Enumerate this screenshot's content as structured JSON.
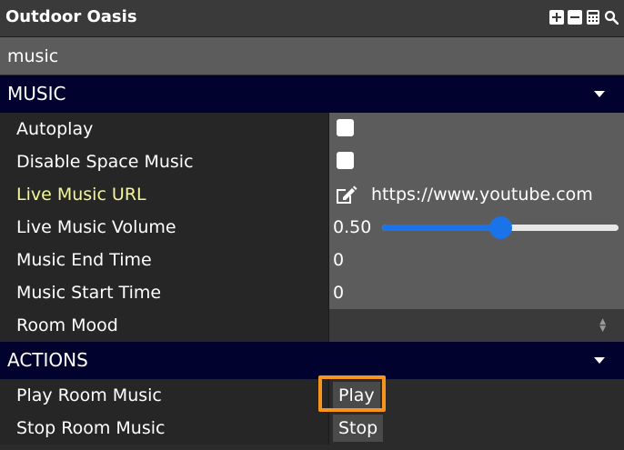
{
  "window": {
    "title": "Outdoor Oasis"
  },
  "toolbar": {
    "icons": [
      "add-icon",
      "remove-icon",
      "calculator-icon",
      "search-icon"
    ]
  },
  "search": {
    "value": "music"
  },
  "sections": {
    "music": {
      "title": "MUSIC",
      "rows": {
        "autoplay": {
          "label": "Autoplay",
          "checked": false
        },
        "disable_space_music": {
          "label": "Disable Space Music",
          "checked": false
        },
        "live_music_url": {
          "label": "Live Music URL",
          "value": "https://www.youtube.com"
        },
        "live_music_volume": {
          "label": "Live Music Volume",
          "value": "0.50",
          "level": 0.5
        },
        "music_end_time": {
          "label": "Music End Time",
          "value": "0"
        },
        "music_start_time": {
          "label": "Music Start Time",
          "value": "0"
        },
        "room_mood": {
          "label": "Room Mood",
          "value": ""
        }
      }
    },
    "actions": {
      "title": "ACTIONS",
      "rows": {
        "play_room_music": {
          "label": "Play Room Music",
          "button": "Play"
        },
        "stop_room_music": {
          "label": "Stop Room Music",
          "button": "Stop"
        }
      }
    }
  },
  "colors": {
    "section_header_bg": "#02022e",
    "highlight_label": "#f5f59a",
    "slider_accent": "#1a73e8",
    "focus_ring": "#f7941d"
  }
}
